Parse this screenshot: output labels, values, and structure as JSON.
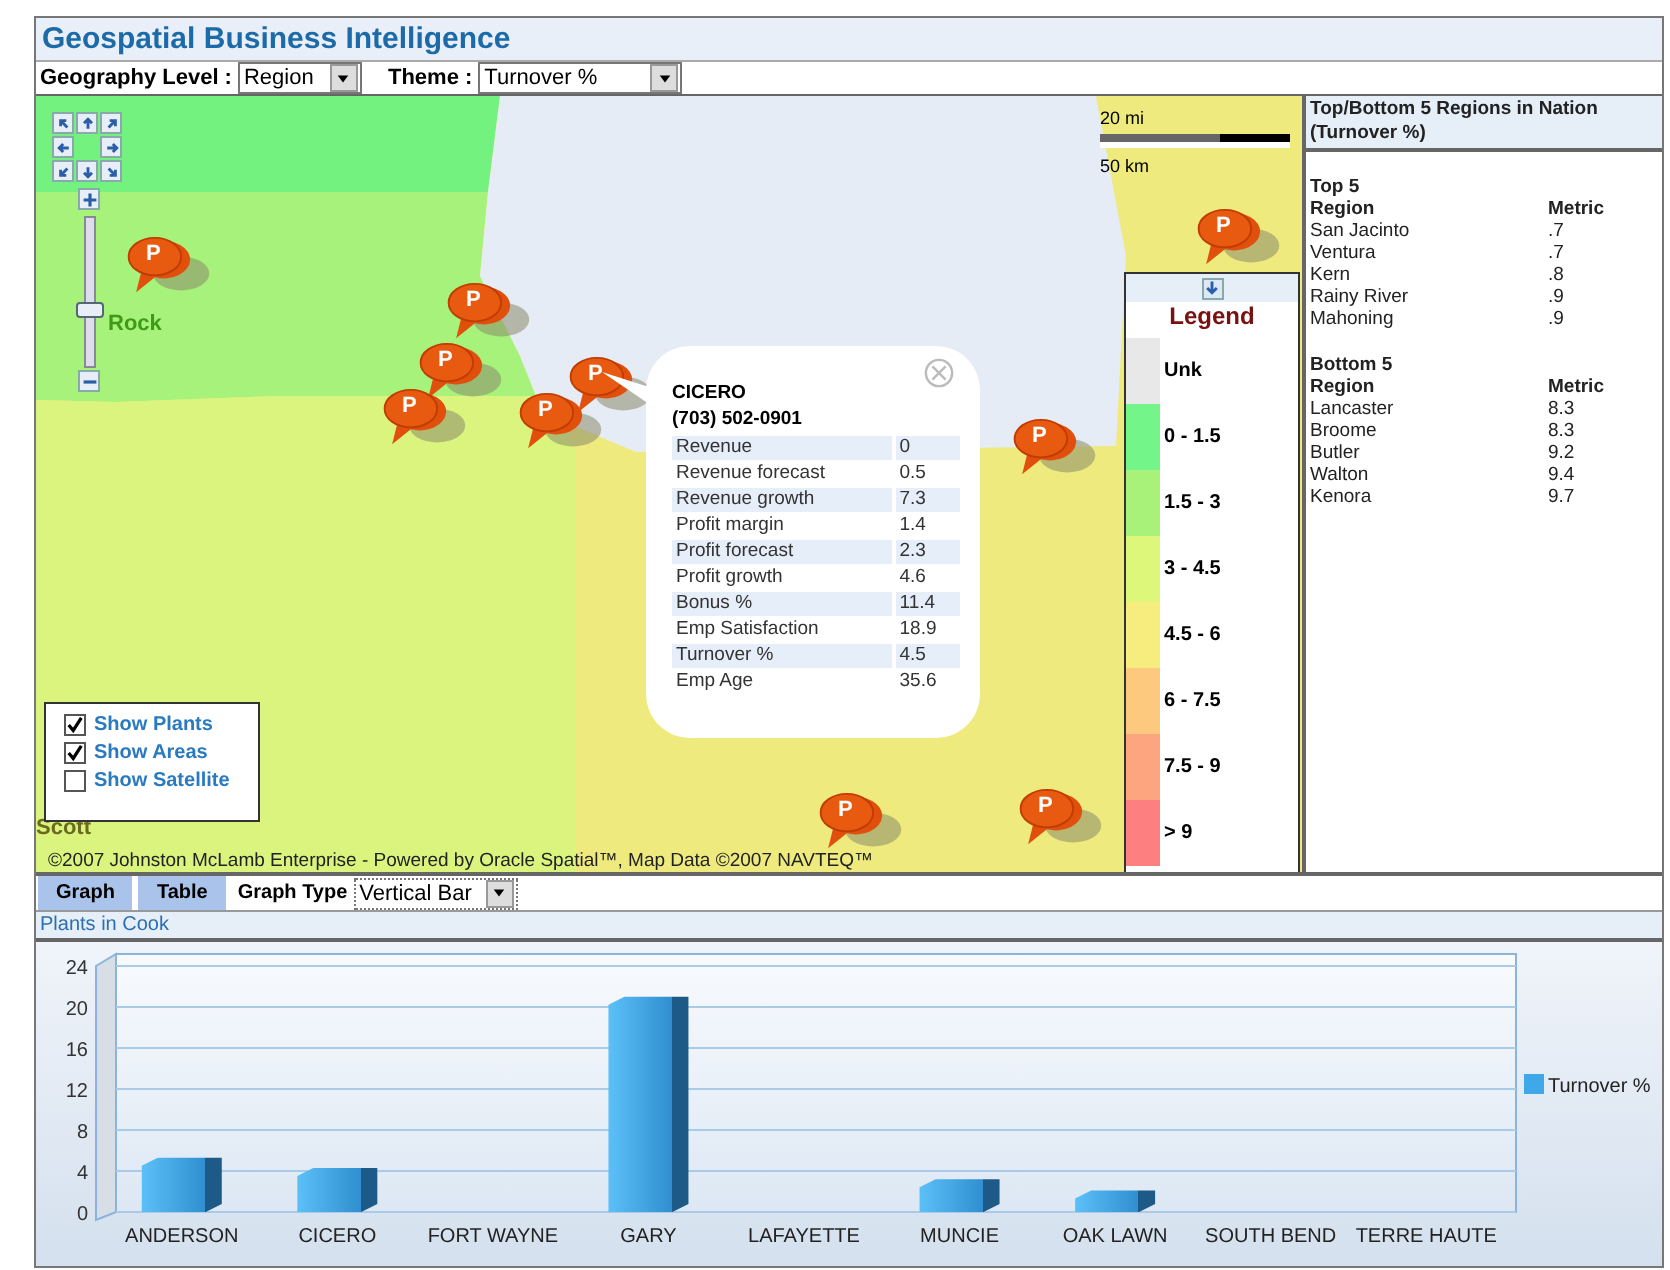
{
  "window": {
    "title": "Geospatial Business Intelligence"
  },
  "toolbar": {
    "geography_label": "Geography Level :",
    "geography_value": "Region",
    "theme_label": "Theme :",
    "theme_value": "Turnover %"
  },
  "map": {
    "scale": {
      "miles": "20 mi",
      "km": "50 km"
    },
    "zoom": {
      "level": 0.38
    },
    "place_labels": [
      {
        "text": "Rock",
        "kind": "green"
      },
      {
        "text": "Scott",
        "kind": "olive"
      }
    ],
    "pins": [
      {
        "label": "P"
      },
      {
        "label": "P"
      },
      {
        "label": "P"
      },
      {
        "label": "P"
      },
      {
        "label": "P"
      },
      {
        "label": "P"
      },
      {
        "label": "P"
      },
      {
        "label": "P"
      },
      {
        "label": "P"
      },
      {
        "label": "P"
      }
    ],
    "popup": {
      "title": "CICERO",
      "phone": "(703) 502-0901",
      "rows": [
        {
          "label": "Revenue",
          "value": "0"
        },
        {
          "label": "Revenue forecast",
          "value": "0.5"
        },
        {
          "label": "Revenue growth",
          "value": "7.3"
        },
        {
          "label": "Profit margin",
          "value": "1.4"
        },
        {
          "label": "Profit forecast",
          "value": "2.3"
        },
        {
          "label": "Profit growth",
          "value": "4.6"
        },
        {
          "label": "Bonus %",
          "value": "11.4"
        },
        {
          "label": "Emp Satisfaction",
          "value": "18.9"
        },
        {
          "label": "Turnover %",
          "value": "4.5"
        },
        {
          "label": "Emp Age",
          "value": "35.6"
        }
      ]
    },
    "legend": {
      "title": "Legend",
      "items": [
        {
          "label": "Unk",
          "color": "#e8e8e8"
        },
        {
          "label": "0 - 1.5",
          "color": "#74f58a"
        },
        {
          "label": "1.5 - 3",
          "color": "#a8f279"
        },
        {
          "label": "3 - 4.5",
          "color": "#dcf77a"
        },
        {
          "label": "4.5 - 6",
          "color": "#f7ed7e"
        },
        {
          "label": "6 - 7.5",
          "color": "#fdc97e"
        },
        {
          "label": "7.5 - 9",
          "color": "#fda57e"
        },
        {
          "label": "> 9",
          "color": "#fd7f7f"
        }
      ]
    },
    "layers": [
      {
        "label": "Show Plants",
        "checked": true
      },
      {
        "label": "Show Areas",
        "checked": true
      },
      {
        "label": "Show Satellite",
        "checked": false
      }
    ],
    "copyright": "©2007 Johnston McLamb Enterprise - Powered by Oracle Spatial™, Map Data ©2007 NAVTEQ™"
  },
  "ranking": {
    "title": "Top/Bottom 5 Regions in Nation (Turnover %)",
    "groups": [
      {
        "title": "Top 5",
        "col_region": "Region",
        "col_metric": "Metric",
        "rows": [
          {
            "region": "San Jacinto",
            "metric": ".7"
          },
          {
            "region": "Ventura",
            "metric": ".7"
          },
          {
            "region": "Kern",
            "metric": ".8"
          },
          {
            "region": "Rainy River",
            "metric": ".9"
          },
          {
            "region": "Mahoning",
            "metric": ".9"
          }
        ]
      },
      {
        "title": "Bottom 5",
        "col_region": "Region",
        "col_metric": "Metric",
        "rows": [
          {
            "region": "Lancaster",
            "metric": "8.3"
          },
          {
            "region": "Broome",
            "metric": "8.3"
          },
          {
            "region": "Butler",
            "metric": "9.2"
          },
          {
            "region": "Walton",
            "metric": "9.4"
          },
          {
            "region": "Kenora",
            "metric": "9.7"
          }
        ]
      }
    ]
  },
  "view_tabs": [
    {
      "label": "Graph"
    },
    {
      "label": "Table"
    }
  ],
  "graph_type": {
    "label": "Graph Type",
    "value": "Vertical Bar"
  },
  "section_title": "Plants in Cook",
  "chart": {
    "chart_data": {
      "type": "bar",
      "categories": [
        "ANDERSON",
        "CICERO",
        "FORT WAYNE",
        "GARY",
        "LAFAYETTE",
        "MUNCIE",
        "OAK LAWN",
        "SOUTH BEND",
        "TERRE HAUTE"
      ],
      "series": [
        {
          "name": "Turnover %",
          "color": "#3ea8e8",
          "values": [
            5.3,
            4.3,
            0,
            21,
            0,
            3.2,
            2.1,
            0,
            0
          ]
        }
      ],
      "ylim": [
        0,
        24
      ],
      "grid": true,
      "yticks": [
        0,
        4,
        8,
        12,
        16,
        20,
        24
      ]
    }
  }
}
